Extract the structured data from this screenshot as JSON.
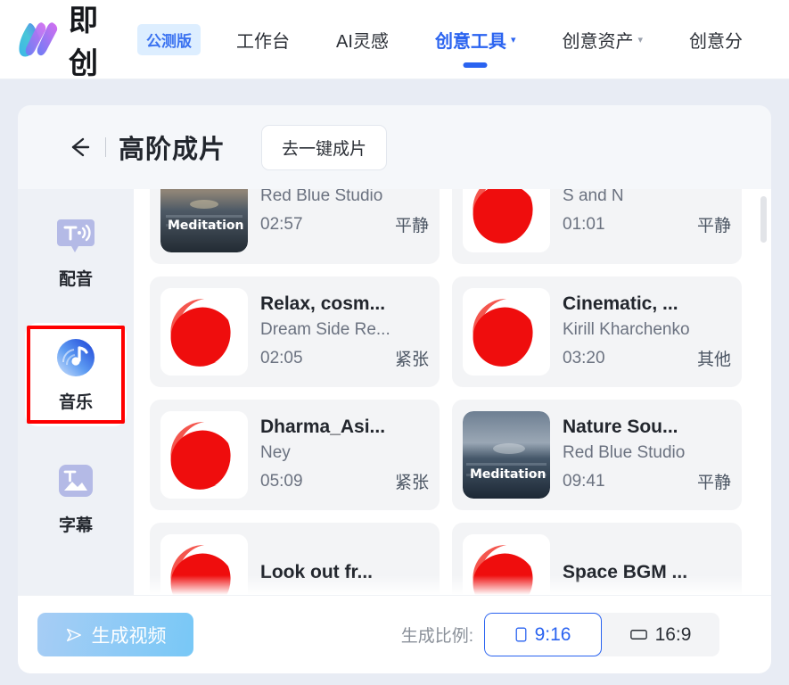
{
  "header": {
    "logo_icon": "jichuang-logo-icon",
    "logo_text": "即创",
    "beta_badge": "公测版",
    "nav": [
      {
        "label": "工作台",
        "active": false,
        "caret": false
      },
      {
        "label": "AI灵感",
        "active": false,
        "caret": false
      },
      {
        "label": "创意工具",
        "active": true,
        "caret": true,
        "caret_glyph": "▾"
      },
      {
        "label": "创意资产",
        "active": false,
        "caret": true,
        "caret_glyph": "▾"
      },
      {
        "label": "创意分",
        "active": false,
        "caret": false
      }
    ]
  },
  "title_bar": {
    "back_icon": "back-arrow-icon",
    "title": "高阶成片",
    "onekey_button": "去一键成片"
  },
  "sidebar": {
    "items": [
      {
        "label": "配音",
        "icon": "voiceover-icon",
        "selected": false
      },
      {
        "label": "音乐",
        "icon": "music-icon",
        "selected": true
      },
      {
        "label": "字幕",
        "icon": "subtitle-icon",
        "selected": false
      }
    ]
  },
  "music_list": {
    "cards": [
      {
        "title": "",
        "artist": "Red Blue Studio",
        "duration": "02:57",
        "mood": "平静",
        "thumb": "meditation-ocean",
        "thumb_label": "Meditation"
      },
      {
        "title": "",
        "artist": "S and N",
        "duration": "01:01",
        "mood": "平静",
        "thumb": "red-crescent",
        "thumb_label": ""
      },
      {
        "title": "Relax, cosm...",
        "artist": "Dream Side Re...",
        "duration": "02:05",
        "mood": "紧张",
        "thumb": "red-crescent",
        "thumb_label": ""
      },
      {
        "title": "Cinematic, ...",
        "artist": "Kirill Kharchenko",
        "duration": "03:20",
        "mood": "其他",
        "thumb": "red-crescent",
        "thumb_label": ""
      },
      {
        "title": "Dharma_Asi...",
        "artist": "Ney",
        "duration": "05:09",
        "mood": "紧张",
        "thumb": "red-crescent",
        "thumb_label": ""
      },
      {
        "title": "Nature Sou...",
        "artist": "Red Blue Studio",
        "duration": "09:41",
        "mood": "平静",
        "thumb": "meditation-ocean",
        "thumb_label": "Meditation"
      },
      {
        "title": "Look out fr...",
        "artist": "",
        "duration": "",
        "mood": "",
        "thumb": "red-crescent",
        "thumb_label": ""
      },
      {
        "title": "Space BGM ...",
        "artist": "",
        "duration": "",
        "mood": "",
        "thumb": "red-crescent",
        "thumb_label": ""
      }
    ]
  },
  "footer": {
    "generate_button": "生成视频",
    "generate_icon": "send-play-icon",
    "ratio_label": "生成比例:",
    "ratios": [
      {
        "label": "9:16",
        "icon": "portrait-icon",
        "active": true
      },
      {
        "label": "16:9",
        "icon": "landscape-icon",
        "active": false
      }
    ]
  },
  "colors": {
    "accent": "#2a63f0",
    "highlight": "#ff0000",
    "page_bg": "#e8ecf4",
    "panel_bg": "#f5f7fa"
  }
}
